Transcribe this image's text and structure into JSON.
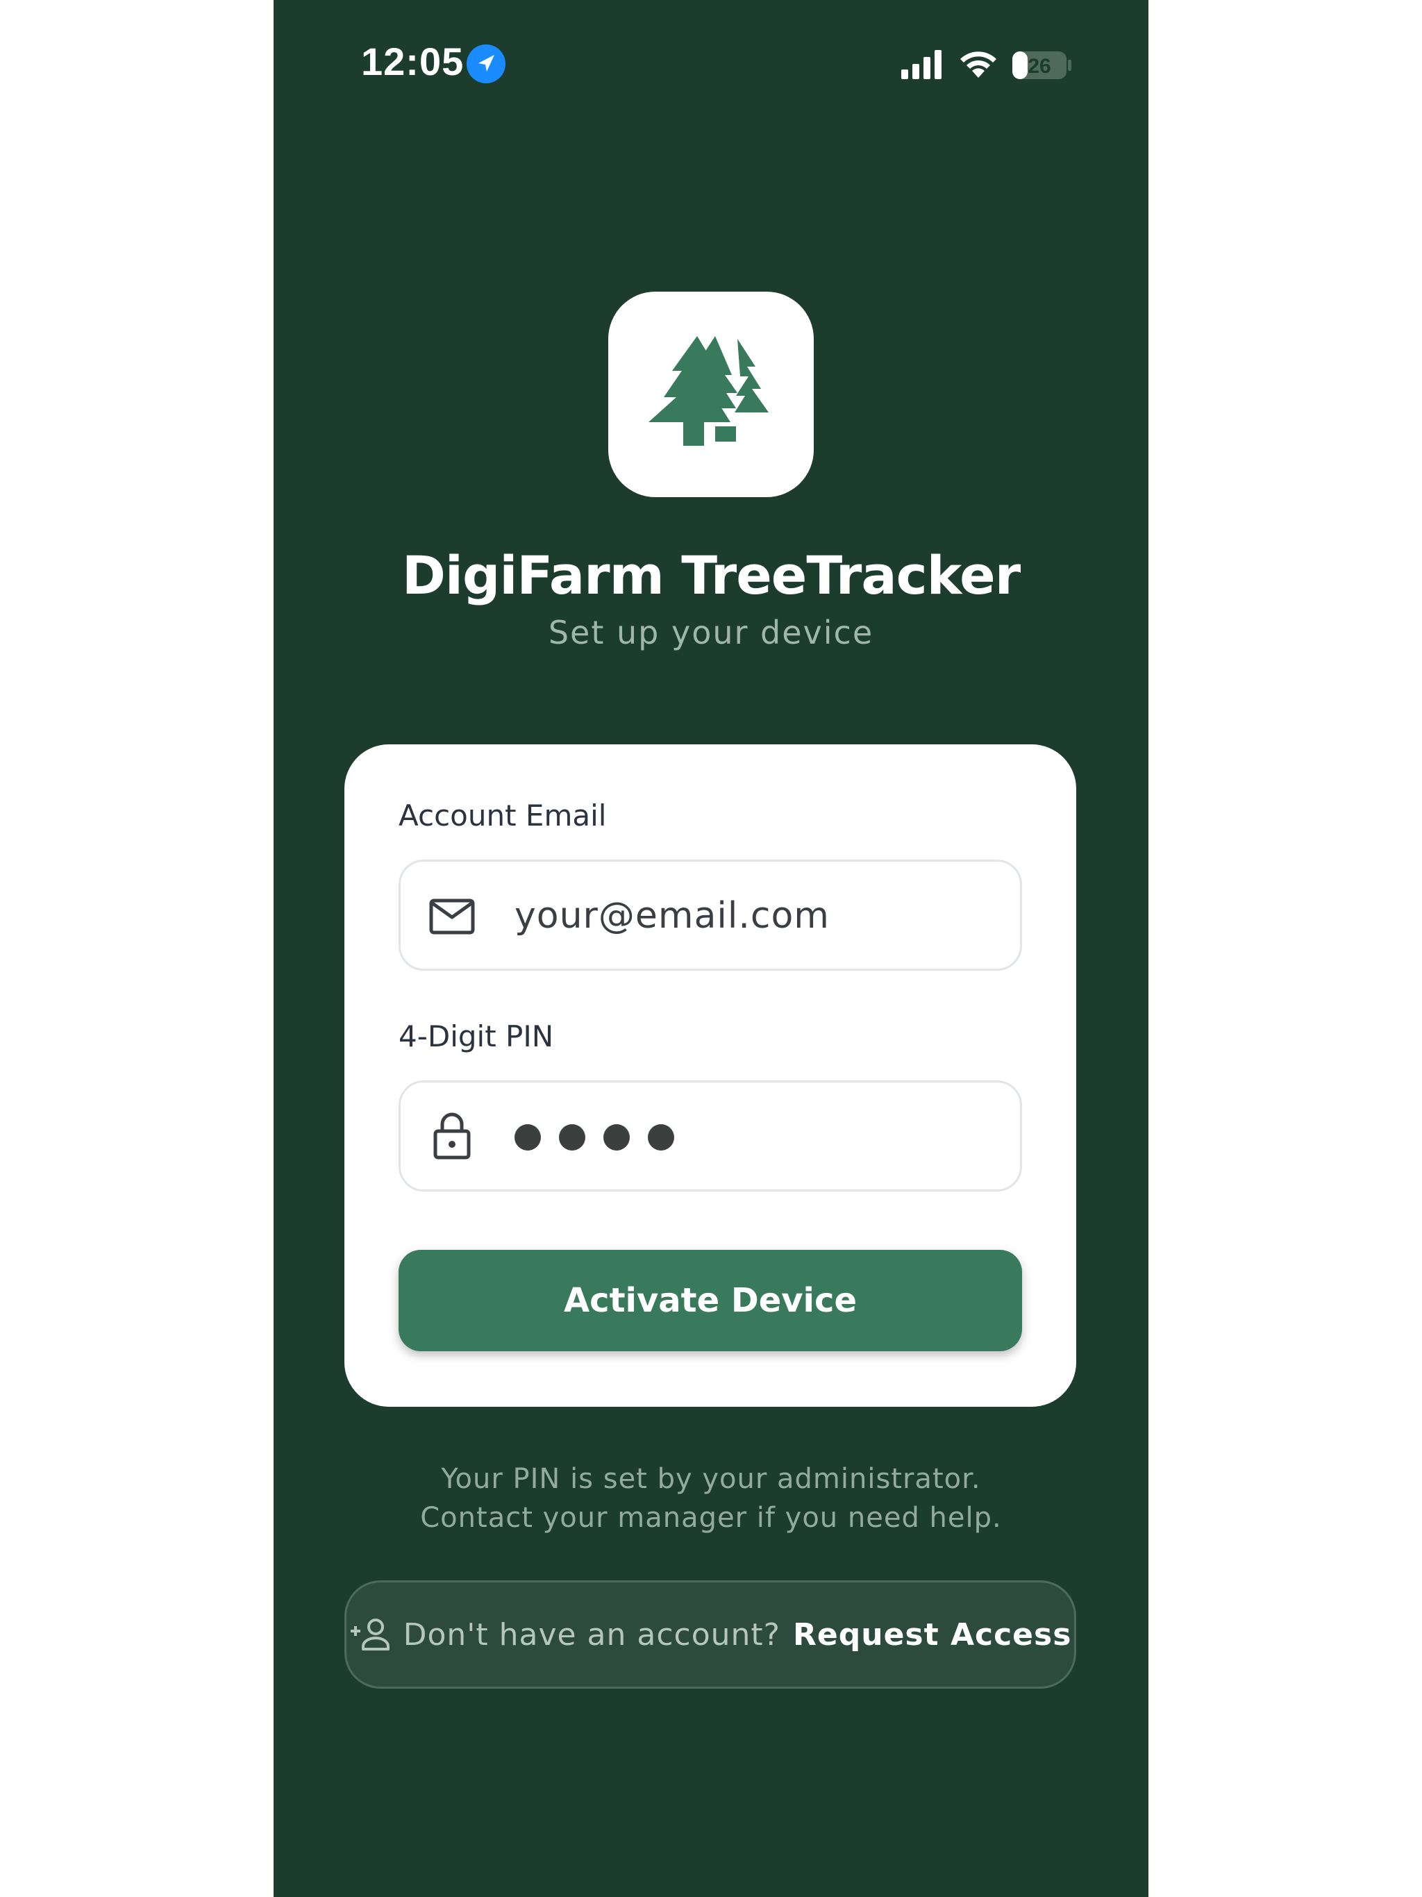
{
  "status_bar": {
    "time": "12:05",
    "battery_level": "26",
    "icons": [
      "location-arrow-icon",
      "cellular-signal-icon",
      "wifi-icon",
      "battery-icon"
    ]
  },
  "app": {
    "logo_icon": "pine-trees-icon",
    "title": "DigiFarm TreeTracker",
    "subtitle": "Set up your device"
  },
  "form": {
    "email_label": "Account Email",
    "email_value": "your@email.com",
    "email_icon": "mail-icon",
    "pin_label": "4-Digit PIN",
    "pin_icon": "lock-icon",
    "pin_length": 4,
    "activate_label": "Activate Device"
  },
  "help": {
    "line1": "Your PIN is set by your administrator.",
    "line2": "Contact your manager if you need help."
  },
  "request_access": {
    "icon": "person-add-icon",
    "prompt": "Don't have an account?",
    "link": "Request Access"
  },
  "colors": {
    "background": "#1c3c2e",
    "brand_green": "#3a7a5c",
    "card": "#ffffff",
    "location_blue": "#1a8cff"
  }
}
